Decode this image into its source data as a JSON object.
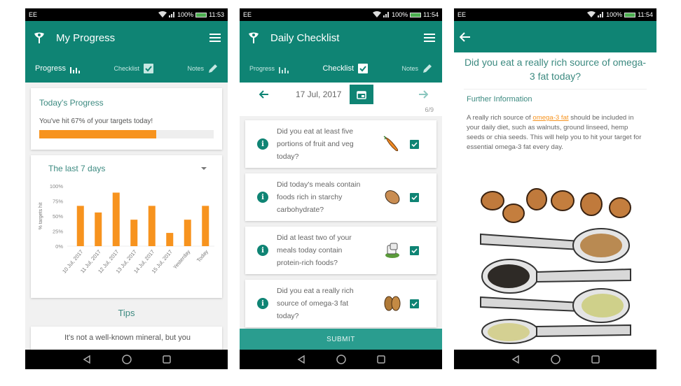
{
  "status_bar": {
    "carrier": "EE",
    "battery": "100%",
    "times": [
      "11:53",
      "11:54",
      "11:54"
    ]
  },
  "colors": {
    "primary": "#0f8474",
    "accent": "#f7931e",
    "submit": "#2a9d8f"
  },
  "tabs": [
    {
      "label": "Progress",
      "icon": "bar-chart-icon"
    },
    {
      "label": "Checklist",
      "icon": "checkbox-icon"
    },
    {
      "label": "Notes",
      "icon": "pencil-icon"
    }
  ],
  "screen1": {
    "title": "My Progress",
    "active_tab": "Progress",
    "today": {
      "heading": "Today's Progress",
      "text": "You've hit 67% of your targets today!",
      "progress_percent": 67
    },
    "week": {
      "heading": "The last 7 days"
    },
    "tips": {
      "title": "Tips",
      "text": "It's not a well-known mineral, but you"
    }
  },
  "chart_data": {
    "type": "bar",
    "title": "The last 7 days",
    "xlabel": "",
    "ylabel": "% targets hit",
    "categories": [
      "10 Jul, 2017",
      "11 Jul, 2017",
      "12 Jul, 2017",
      "13 Jul, 2017",
      "14 Jul, 2017",
      "15 Jul, 2017",
      "Yesterday",
      "Today"
    ],
    "values": [
      67,
      56,
      89,
      44,
      67,
      22,
      44,
      67
    ],
    "yticks": [
      "0%",
      "25%",
      "50%",
      "75%",
      "100%"
    ],
    "ylim": [
      0,
      100
    ],
    "grid": false,
    "color": "#f7931e"
  },
  "screen2": {
    "title": "Daily Checklist",
    "active_tab": "Checklist",
    "date": "17 Jul, 2017",
    "count": "6/9",
    "items": [
      {
        "text": "Did you eat at least five portions of fruit and veg today?",
        "food_icon": "carrot-icon",
        "checked": true
      },
      {
        "text": "Did today's meals contain foods rich in starchy carbohydrate?",
        "food_icon": "potato-icon",
        "checked": true
      },
      {
        "text": "Did at least two of your meals today contain protein-rich foods?",
        "food_icon": "protein-icon",
        "checked": true
      },
      {
        "text": "Did you eat a really rich source of omega-3 fat today?",
        "food_icon": "walnut-icon",
        "checked": true
      }
    ],
    "submit_label": "SUBMIT"
  },
  "screen3": {
    "question": "Did you eat a really rich source of omega-3 fat today?",
    "further_heading": "Further Information",
    "info_before": "A really rich source of ",
    "info_link": "omega-3 fat",
    "info_after": " should be included in your daily diet, such as walnuts, ground linseed, hemp seeds or chia seeds. This will help you to hit your target for essential omega-3 fat every day."
  }
}
